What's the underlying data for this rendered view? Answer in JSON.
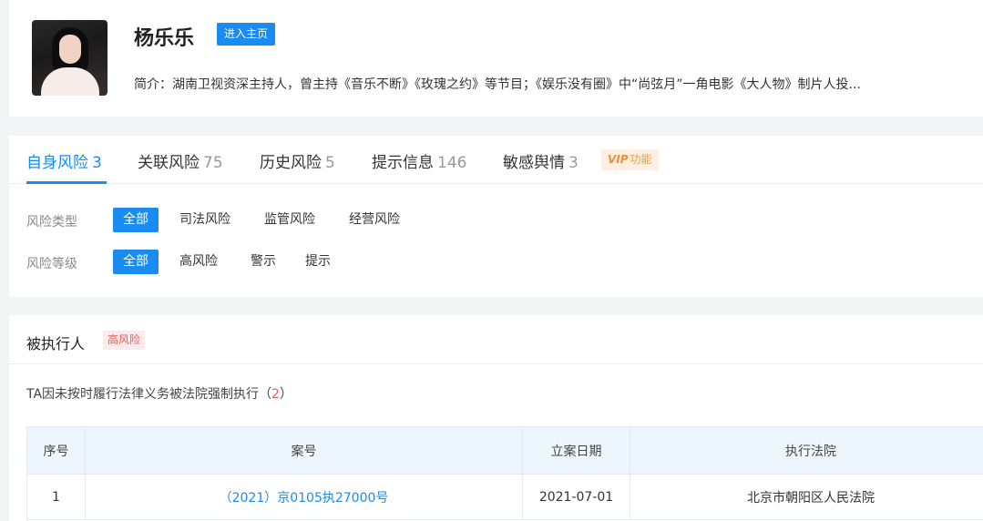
{
  "profile": {
    "name": "杨乐乐",
    "home_button": "进入主页",
    "intro": "简介：湖南卫视资深主持人，曾主持《音乐不断》《玫瑰之约》等节目；《娱乐没有圈》中“尚弦月”一角电影《大人物》制片人投..."
  },
  "risk_tabs": [
    {
      "label": "自身风险",
      "count": "3"
    },
    {
      "label": "关联风险",
      "count": "75"
    },
    {
      "label": "历史风险",
      "count": "5"
    },
    {
      "label": "提示信息",
      "count": "146"
    },
    {
      "label": "敏感舆情",
      "count": "3"
    }
  ],
  "vip": {
    "prefix": "VIP",
    "label": "功能"
  },
  "filters": {
    "type_label": "风险类型",
    "type_options": [
      "全部",
      "司法风险",
      "监管风险",
      "经营风险"
    ],
    "level_label": "风险等级",
    "level_options": [
      "全部",
      "高风险",
      "警示",
      "提示"
    ]
  },
  "executed": {
    "title": "被执行人",
    "tag": "高风险",
    "desc": "TA因未按时履行法律义务被法院强制执行",
    "desc_open": "（",
    "desc_count": "2",
    "desc_close": "）",
    "columns": [
      "序号",
      "案号",
      "立案日期",
      "执行法院"
    ],
    "rows": [
      {
        "index": "1",
        "case_no": "（2021）京0105执27000号",
        "date": "2021-07-01",
        "court": "北京市朝阳区人民法院"
      }
    ]
  },
  "colors": {
    "accent": "#1a8bf0",
    "danger": "#ec5a5a",
    "vip": "#e9903a"
  }
}
